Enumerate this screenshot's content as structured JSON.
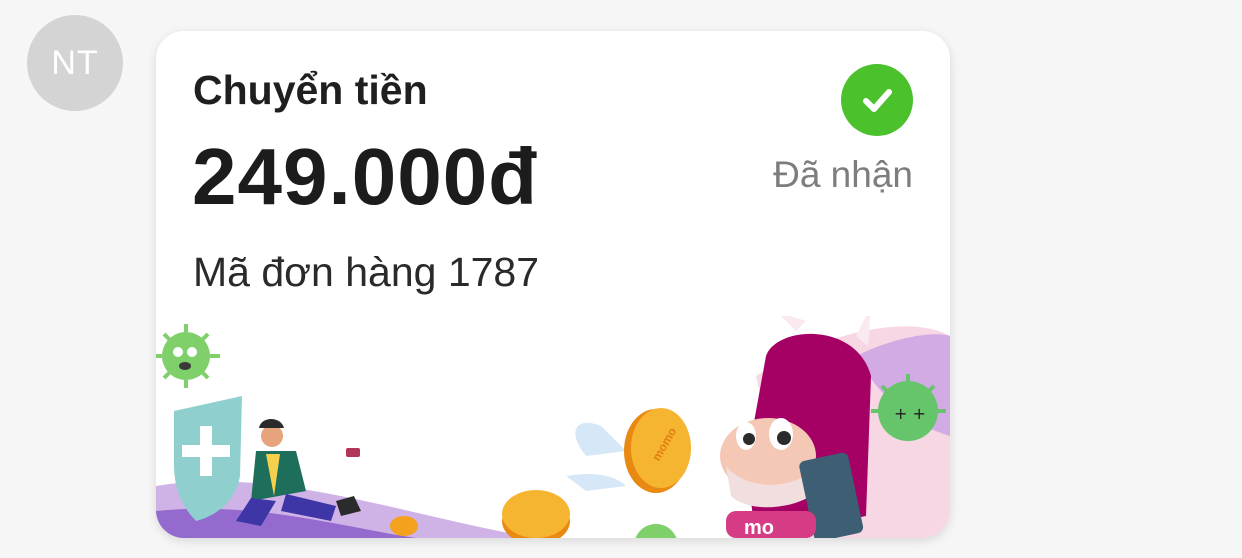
{
  "avatar": {
    "initials": "NT"
  },
  "card": {
    "title": "Chuyển tiền",
    "amount": "249.000đ",
    "order": "Mã đơn hàng 1787",
    "status": "Đã nhận",
    "status_icon": "check-circle-icon",
    "coin_label": "momo"
  },
  "colors": {
    "status_green": "#4bc12c",
    "brand_pink": "#a50064",
    "coin_gold": "#f4a11d"
  }
}
